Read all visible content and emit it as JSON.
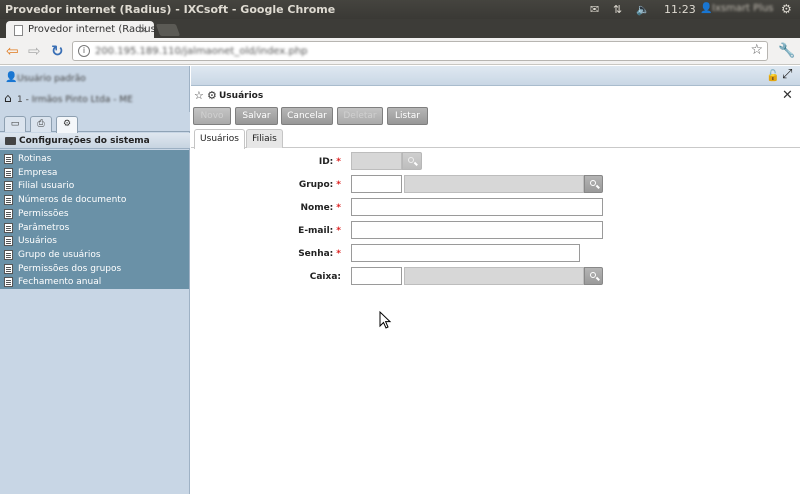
{
  "os": {
    "window_title": "Provedor internet (Radius) - IXCsoft - Google Chrome",
    "time": "11:23",
    "user": "Ixsmart Plus"
  },
  "browser": {
    "tab_title": "Provedor internet (Radius",
    "url": "200.195.189.110/jalmaonet_old/index.php"
  },
  "left": {
    "user_label": "Usuário padrão",
    "company_label": "1 - ",
    "company_blurred": "Irmãos Pinto Ltda - ME",
    "section_title": "Configurações do sistema",
    "menu": [
      "Rotinas",
      "Empresa",
      "Filial usuario",
      "Números de documento",
      "Permissões",
      "Parâmetros",
      "Usuários",
      "Grupo de usuários",
      "Permissões dos grupos",
      "Fechamento anual"
    ]
  },
  "form": {
    "title": "Usuários",
    "buttons": {
      "novo": "Novo",
      "salvar": "Salvar",
      "cancelar": "Cancelar",
      "deletar": "Deletar",
      "listar": "Listar"
    },
    "tabs": [
      "Usuários",
      "Filiais"
    ],
    "fields": {
      "id": "ID:",
      "grupo": "Grupo:",
      "nome": "Nome:",
      "email": "E-mail:",
      "senha": "Senha:",
      "caixa": "Caixa:"
    },
    "required_mark": "*"
  }
}
